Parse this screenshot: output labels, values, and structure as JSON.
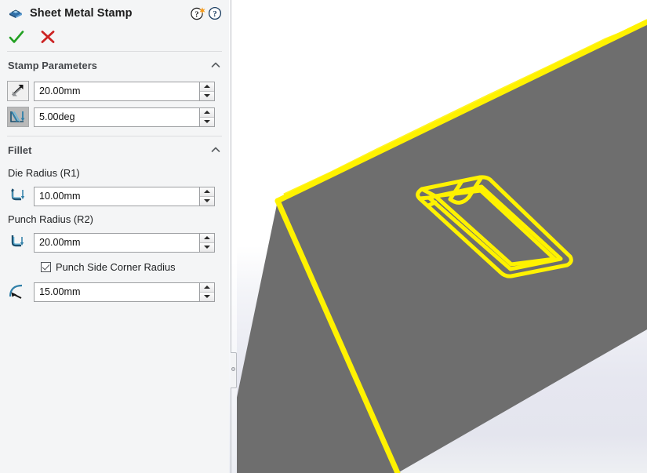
{
  "panel": {
    "title": "Sheet Metal Stamp",
    "title_icon": "sheet-metal-stamp-icon",
    "help_icons": [
      "help-whats-new-icon",
      "help-icon"
    ],
    "confirm": {
      "ok_icon": "check-icon",
      "cancel_icon": "close-icon"
    },
    "sections": [
      {
        "id": "stamp-parameters",
        "title": "Stamp Parameters",
        "collapse_icon": "chevron-up-icon",
        "fields": [
          {
            "id": "stamp-depth",
            "icon": "stamp-depth-icon",
            "icon_style": "boxed",
            "value": "20.00mm",
            "placeholder": "Depth",
            "spinner_up": "spinner-up-icon",
            "spinner_down": "spinner-down-icon"
          },
          {
            "id": "draft-angle",
            "icon": "draft-angle-icon",
            "icon_style": "boxed-shaded",
            "value": "5.00deg",
            "placeholder": "Angle",
            "spinner_up": "spinner-up-icon",
            "spinner_down": "spinner-down-icon"
          }
        ]
      },
      {
        "id": "fillet",
        "title": "Fillet",
        "collapse_icon": "chevron-up-icon",
        "labels": {
          "die_radius": "Die Radius (R1)",
          "punch_radius": "Punch Radius (R2)"
        },
        "fields": [
          {
            "id": "die-radius",
            "icon": "die-radius-icon",
            "icon_style": "plain",
            "value": "10.00mm",
            "placeholder": "Die radius",
            "spinner_up": "spinner-up-icon",
            "spinner_down": "spinner-down-icon"
          },
          {
            "id": "punch-radius",
            "icon": "punch-radius-icon",
            "icon_style": "plain",
            "value": "20.00mm",
            "placeholder": "Punch radius",
            "spinner_up": "spinner-up-icon",
            "spinner_down": "spinner-down-icon"
          },
          {
            "id": "punch-side-corner-radius",
            "icon": "corner-radius-icon",
            "icon_style": "plain",
            "value": "15.00mm",
            "placeholder": "Corner radius",
            "spinner_up": "spinner-up-icon",
            "spinner_down": "spinner-down-icon"
          }
        ],
        "checkbox": {
          "id": "punch-side-corner-radius-checkbox",
          "label": "Punch Side Corner Radius",
          "checked": true
        }
      }
    ]
  },
  "splitter": {
    "handle_icon": "panel-collapse-handle"
  },
  "viewport": {
    "name": "3d-graphics-area",
    "model": "sheet-metal-plate-with-stamp",
    "highlight_color": "#fff200",
    "face_color": "#6e6e6e",
    "background_top": "#ffffff",
    "background_bottom": "#e6e7f0"
  },
  "colors": {
    "accent_yellow": "#fff200",
    "ok_green": "#22a022",
    "cancel_red": "#cc2222",
    "panel_bg": "#f4f5f6",
    "section_title": "#44474b"
  }
}
